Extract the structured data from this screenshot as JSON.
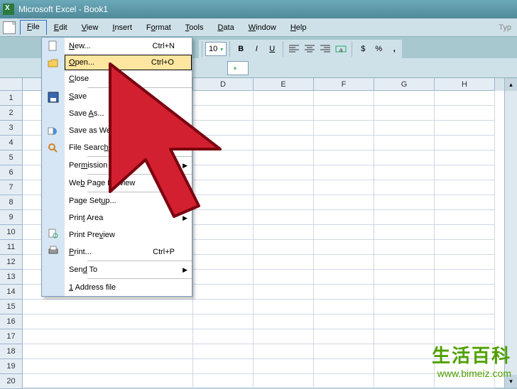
{
  "titlebar": {
    "app": "Microsoft Excel",
    "doc": "Book1"
  },
  "menubar": {
    "file": "File",
    "edit": "Edit",
    "view": "View",
    "insert": "Insert",
    "format": "Format",
    "tools": "Tools",
    "data": "Data",
    "window": "Window",
    "help": "Help",
    "type_help": "Typ"
  },
  "toolbar": {
    "font_size": "10",
    "currency": "$",
    "percent": "%"
  },
  "file_menu": {
    "new": "New...",
    "new_sc": "Ctrl+N",
    "open": "Open...",
    "open_sc": "Ctrl+O",
    "close": "Close",
    "save": "Save",
    "save_as": "Save As...",
    "save_web": "Save as Web P",
    "file_search": "File Search...",
    "permission": "Permission",
    "web_preview": "Web Page Preview",
    "page_setup": "Page Setup...",
    "print_area": "Print Area",
    "print_preview": "Print Preview",
    "print": "Print...",
    "print_sc": "Ctrl+P",
    "send_to": "Send To",
    "recent1": "1 Address file"
  },
  "columns": [
    "D",
    "E",
    "F",
    "G",
    "H"
  ],
  "rows": [
    1,
    2,
    3,
    4,
    5,
    6,
    7,
    8,
    9,
    10,
    11,
    12,
    13,
    14,
    15,
    16,
    17,
    18,
    19,
    20
  ],
  "watermark": {
    "text": "生活百科",
    "url": "www.bimeiz.com"
  }
}
